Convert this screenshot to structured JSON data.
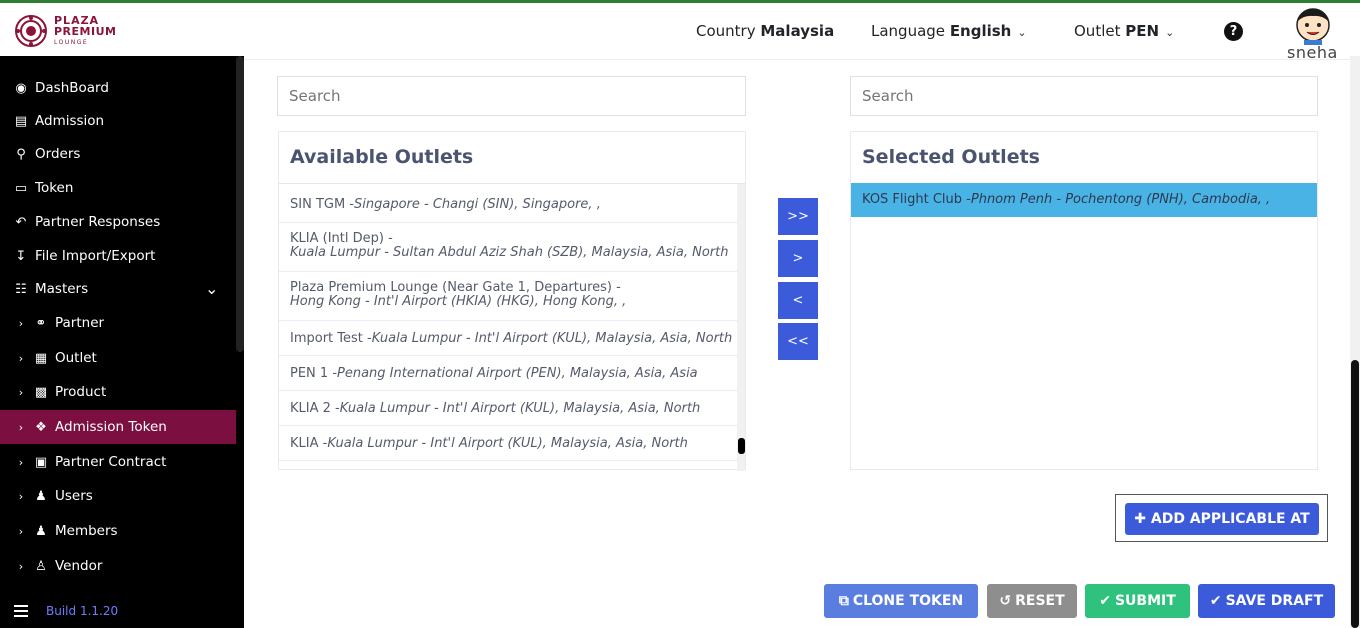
{
  "header": {
    "logo": {
      "line1": "PLAZA",
      "line2": "PREMIUM",
      "line3": "LOUNGE"
    },
    "country_label": "Country",
    "country_value": "Malaysia",
    "language_label": "Language",
    "language_value": "English",
    "outlet_label": "Outlet",
    "outlet_value": "PEN",
    "user_name": "sneha"
  },
  "sidebar": {
    "items": [
      {
        "label": "DashBoard",
        "icon": "dashboard-icon"
      },
      {
        "label": "Admission",
        "icon": "id-card-icon"
      },
      {
        "label": "Orders",
        "icon": "cart-icon"
      },
      {
        "label": "Token",
        "icon": "file-icon"
      },
      {
        "label": "Partner Responses",
        "icon": "reply-all-icon"
      },
      {
        "label": "File Import/Export",
        "icon": "download-icon"
      },
      {
        "label": "Masters",
        "icon": "sitemap-icon"
      }
    ],
    "sub_items": [
      {
        "label": "Partner",
        "icon": "handshake-icon"
      },
      {
        "label": "Outlet",
        "icon": "building-icon"
      },
      {
        "label": "Product",
        "icon": "gift-icon"
      },
      {
        "label": "Admission Token",
        "icon": "tag-icon"
      },
      {
        "label": "Partner Contract",
        "icon": "briefcase-icon"
      },
      {
        "label": "Users",
        "icon": "user-icon"
      },
      {
        "label": "Members",
        "icon": "users-icon"
      },
      {
        "label": "Vendor",
        "icon": "male-icon"
      }
    ],
    "active": "Admission Token",
    "build": "Build 1.1.20"
  },
  "available": {
    "search_placeholder": "Search",
    "title": "Available Outlets",
    "items": [
      {
        "name": "SIN TGM -",
        "detail": "Singapore - Changi (SIN), Singapore, ,"
      },
      {
        "name": "KLIA (Intl Dep) -",
        "detail": "Kuala Lumpur - Sultan Abdul Aziz Shah (SZB), Malaysia, Asia, North"
      },
      {
        "name": "Plaza Premium Lounge (Near Gate 1, Departures) -",
        "detail": "Hong Kong - Int'l Airport (HKIA) (HKG), Hong Kong, ,"
      },
      {
        "name": "Import Test -",
        "detail": "Kuala Lumpur - Int'l Airport (KUL), Malaysia, Asia, North"
      },
      {
        "name": "PEN 1 -",
        "detail": "Penang International Airport (PEN), Malaysia, Asia, Asia"
      },
      {
        "name": "KLIA 2 -",
        "detail": "Kuala Lumpur - Int'l Airport (KUL), Malaysia, Asia, North"
      },
      {
        "name": "KLIA -",
        "detail": "Kuala Lumpur - Int'l Airport (KUL), Malaysia, Asia, North"
      }
    ]
  },
  "selected": {
    "search_placeholder": "Search",
    "title": "Selected Outlets",
    "items": [
      {
        "name": "KOS Flight Club -",
        "detail": "Phnom Penh - Pochentong (PNH), Cambodia, ,"
      }
    ]
  },
  "move_buttons": {
    "all_right": ">>",
    "right": ">",
    "left": "<",
    "all_left": "<<"
  },
  "actions": {
    "add_applicable": "ADD APPLICABLE AT",
    "clone": "CLONE TOKEN",
    "reset": "RESET",
    "submit": "SUBMIT",
    "save_draft": "SAVE DRAFT"
  },
  "colors": {
    "brand": "#8a1538",
    "sidebar_active": "#7b1040",
    "primary": "#3b5bdb",
    "selected_row": "#4ab3e6",
    "clone": "#5a7de0",
    "reset": "#8e8e8e",
    "submit": "#2ec27e"
  }
}
